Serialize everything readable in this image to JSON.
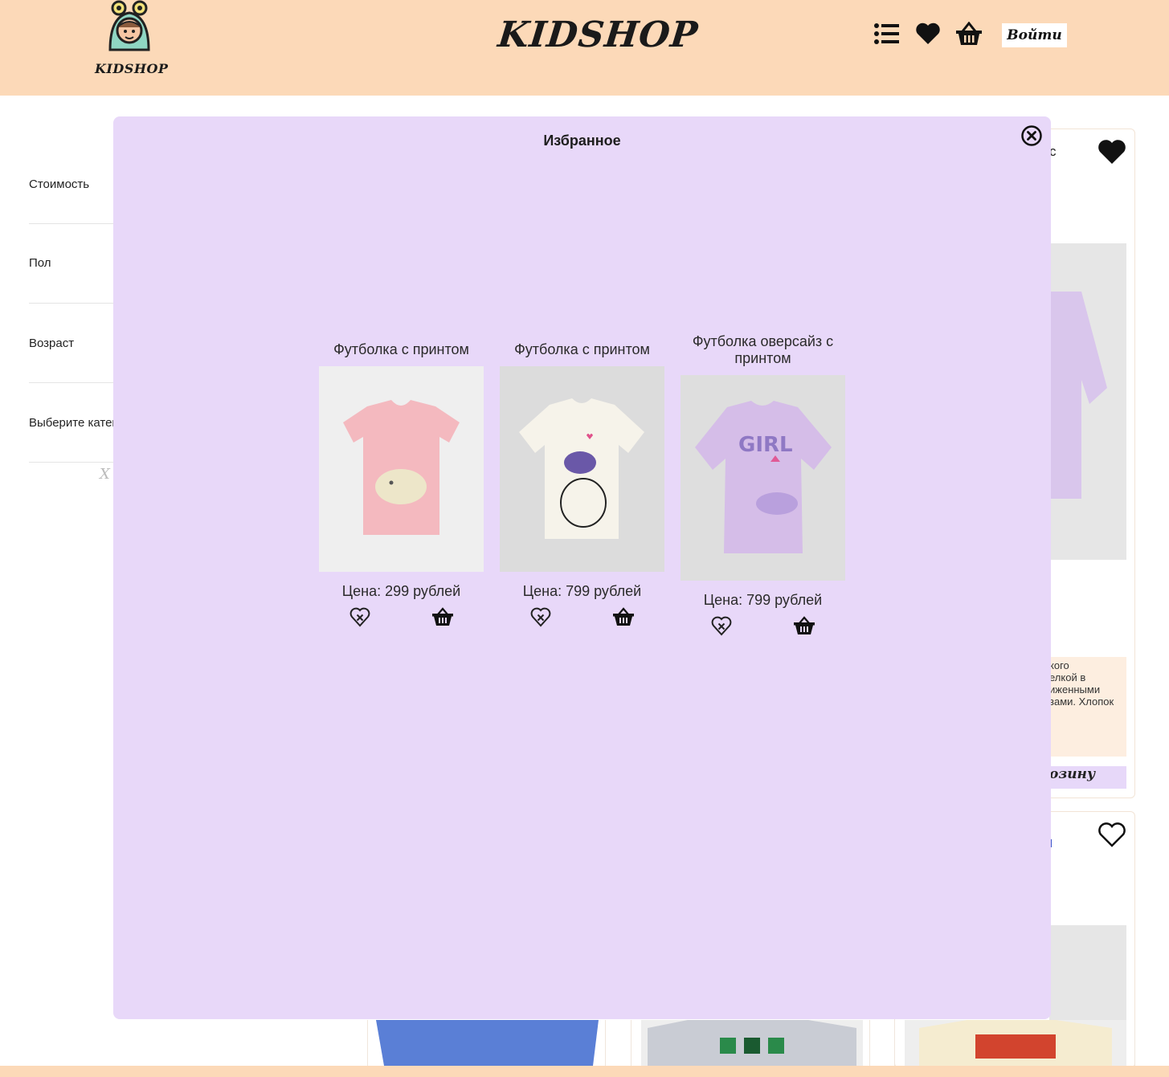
{
  "header": {
    "logo_text": "KIDSHOP",
    "brand": "KIDSHOP",
    "login_label": "Войти",
    "icons": [
      "menu-list-icon",
      "heart-icon",
      "basket-icon"
    ]
  },
  "filters": [
    {
      "label": "Стоимость"
    },
    {
      "label": "Пол"
    },
    {
      "label": "Возраст"
    },
    {
      "label": "Выберите категорию"
    }
  ],
  "filters_clear": "X",
  "background": {
    "card_title_fragment": "с",
    "desc_fragment": [
      "кого",
      "елкой в",
      "иженными",
      "зами. Хлопок"
    ],
    "cart_fragment": "озину"
  },
  "modal": {
    "title": "Избранное",
    "items": [
      {
        "name": "Футболка с принтом",
        "price": "Цена: 299 рублей",
        "color": "#f4b9bf",
        "bg": "#efefef"
      },
      {
        "name": "Футболка с принтом",
        "price": "Цена: 799 рублей",
        "color": "#f6f3ea",
        "bg": "#dcdcdc"
      },
      {
        "name": "Футболка оверсайз с принтом",
        "price": "Цена: 799 рублей",
        "color": "#d5bde8",
        "bg": "#dedede"
      }
    ]
  },
  "colors": {
    "header_bg": "#fcd9b8",
    "modal_bg": "#e8d8f9",
    "accent_lilac": "#e7d8f9"
  }
}
